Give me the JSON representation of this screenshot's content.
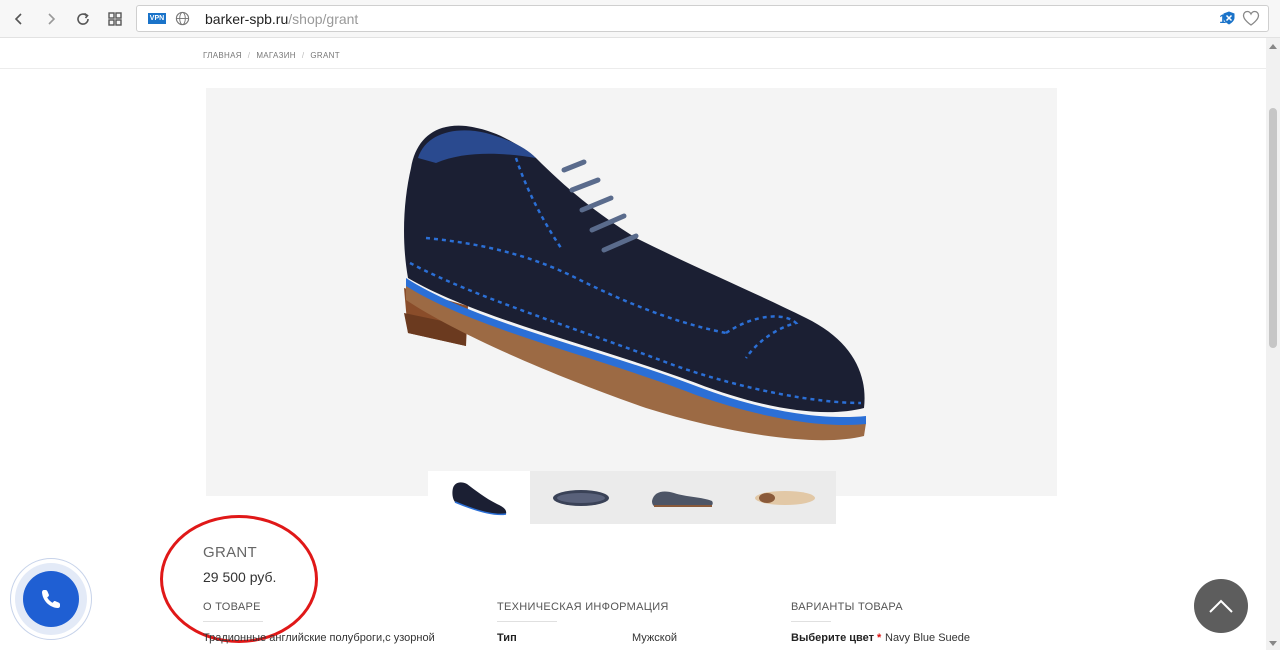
{
  "browser": {
    "back_icon": "chevron-left-icon",
    "forward_icon": "chevron-right-icon",
    "reload_icon": "reload-icon",
    "tabs_icon": "grid-icon",
    "vpn_label": "VPN",
    "url_domain": "barker-spb.ru",
    "url_path": "/shop/grant",
    "extension_count": "1"
  },
  "breadcrumb": {
    "items": [
      "ГЛАВНАЯ",
      "МАГАЗИН",
      "GRANT"
    ],
    "separator": "/"
  },
  "product": {
    "title": "GRANT",
    "price": "29 500 руб.",
    "thumbnail_count": 4,
    "active_thumbnail": 0
  },
  "sections": {
    "about": {
      "heading": "О ТОВАРЕ",
      "text": "Традионные английские полуброги,с узорной"
    },
    "tech": {
      "heading": "ТЕХНИЧЕСКАЯ ИНФОРМАЦИЯ",
      "rows": [
        {
          "label": "Тип",
          "value": "Мужской"
        }
      ]
    },
    "variants": {
      "heading": "ВАРИАНТЫ ТОВАРА",
      "color_label": "Выберите цвет",
      "required_mark": "*",
      "color_value": "Navy Blue Suede"
    }
  },
  "colors": {
    "accent_blue": "#1f5fd3",
    "highlight_red": "#e01818",
    "shoe_navy": "#1b1f33",
    "shoe_trim_blue": "#2b6fd6"
  }
}
